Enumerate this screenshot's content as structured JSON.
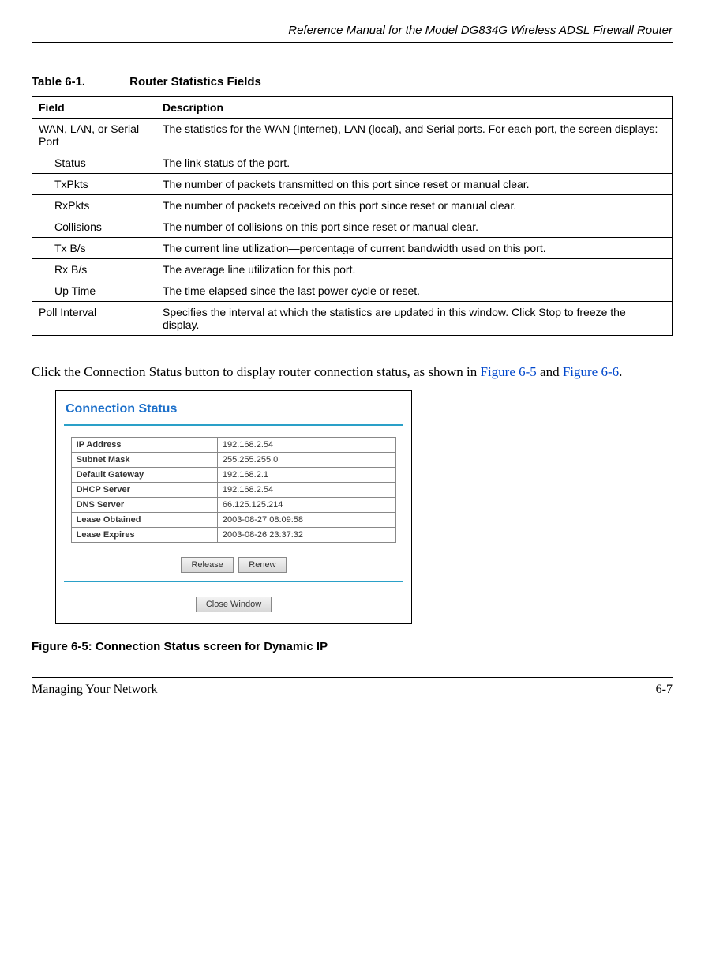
{
  "header": {
    "doc_title": "Reference Manual for the Model DG834G Wireless ADSL Firewall Router"
  },
  "table": {
    "number": "Table 6-1.",
    "title": "Router Statistics Fields",
    "headers": {
      "field": "Field",
      "description": "Description"
    },
    "rows": [
      {
        "field": "WAN, LAN, or Serial Port",
        "desc": "The statistics for the WAN (Internet), LAN (local), and Serial ports. For each port, the screen displays:",
        "indent": false
      },
      {
        "field": "Status",
        "desc": "The link status of the port.",
        "indent": true
      },
      {
        "field": "TxPkts",
        "desc": "The number of packets transmitted on this port since reset or manual clear.",
        "indent": true
      },
      {
        "field": "RxPkts",
        "desc": "The number of packets received on this port since reset or manual clear.",
        "indent": true
      },
      {
        "field": "Collisions",
        "desc": "The number of collisions on this port since reset or manual clear.",
        "indent": true
      },
      {
        "field": "Tx B/s",
        "desc": "The current line utilization—percentage of current bandwidth used on this port.",
        "indent": true
      },
      {
        "field": "Rx B/s",
        "desc": "The average line utilization for this port.",
        "indent": true
      }
    ],
    "row_uptime": {
      "field": "Up Time",
      "desc": "The time elapsed since the last power cycle or reset."
    },
    "row_poll": {
      "field": "Poll Interval",
      "desc": "Specifies the interval at which the statistics are updated in this window. Click Stop to freeze the display."
    }
  },
  "body": {
    "para_prefix": "Click the Connection Status button to display router connection status, as shown in ",
    "link1": "Figure 6-5",
    "para_mid": " and ",
    "link2": "Figure 6-6",
    "para_suffix": "."
  },
  "conn_status": {
    "title": "Connection Status",
    "rows": [
      {
        "k": "IP Address",
        "v": "192.168.2.54"
      },
      {
        "k": "Subnet Mask",
        "v": "255.255.255.0"
      },
      {
        "k": "Default Gateway",
        "v": "192.168.2.1"
      },
      {
        "k": "DHCP Server",
        "v": "192.168.2.54"
      },
      {
        "k": "DNS Server",
        "v": "66.125.125.214"
      },
      {
        "k": "Lease Obtained",
        "v": "2003-08-27 08:09:58"
      },
      {
        "k": "Lease Expires",
        "v": "2003-08-26 23:37:32"
      }
    ],
    "buttons": {
      "release": "Release",
      "renew": "Renew",
      "close": "Close Window"
    }
  },
  "figure_caption": "Figure 6-5:  Connection Status screen for Dynamic IP",
  "footer": {
    "left": "Managing Your Network",
    "right": "6-7"
  }
}
